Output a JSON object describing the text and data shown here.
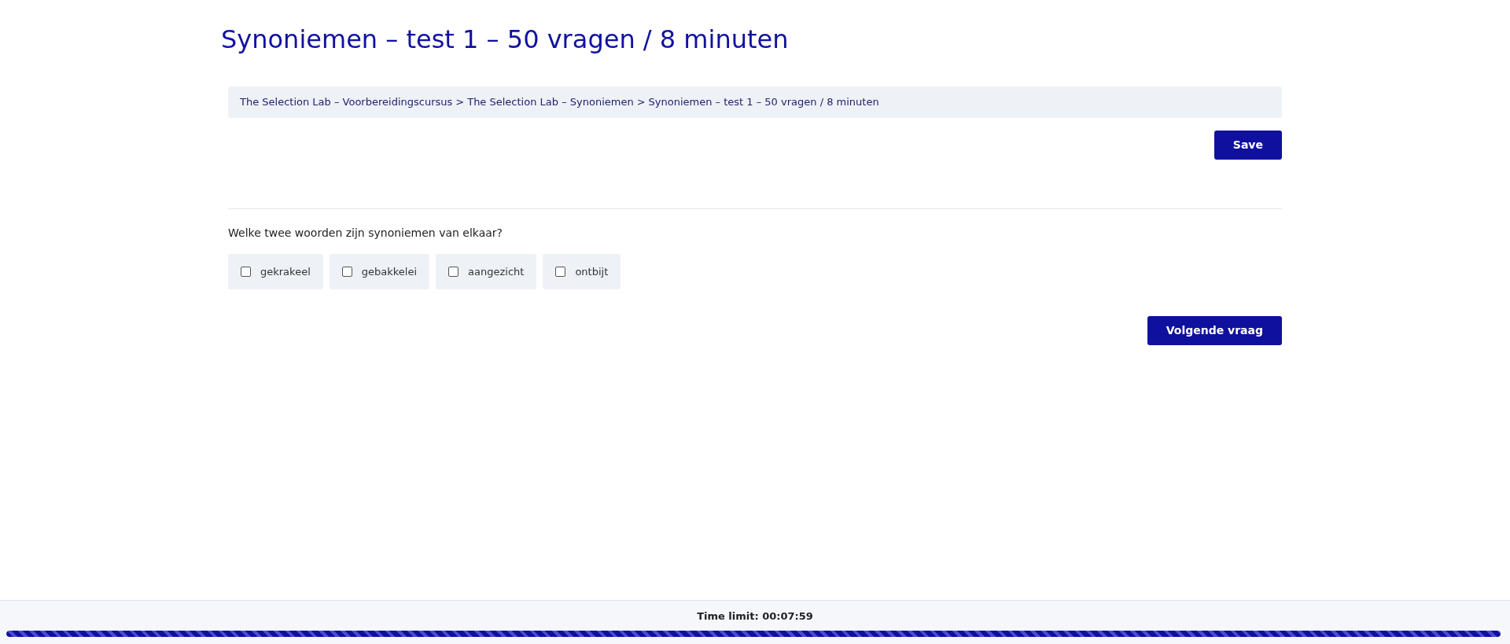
{
  "title": "Synoniemen – test 1 – 50 vragen / 8 minuten",
  "breadcrumb": [
    "The Selection Lab – Voorbereidingscursus",
    "The Selection Lab – Synoniemen",
    "Synoniemen – test 1 – 50 vragen / 8 minuten"
  ],
  "breadcrumb_separator": ">",
  "save_button": "Save",
  "question": "Welke twee woorden zijn synoniemen van elkaar?",
  "options": [
    {
      "label": "gekrakeel",
      "checked": false
    },
    {
      "label": "gebakkelei",
      "checked": false
    },
    {
      "label": "aangezicht",
      "checked": false
    },
    {
      "label": "ontbijt",
      "checked": false
    }
  ],
  "next_button": "Volgende vraag",
  "timer": {
    "label": "Time limit: 00:07:59",
    "level": 0.998
  }
}
